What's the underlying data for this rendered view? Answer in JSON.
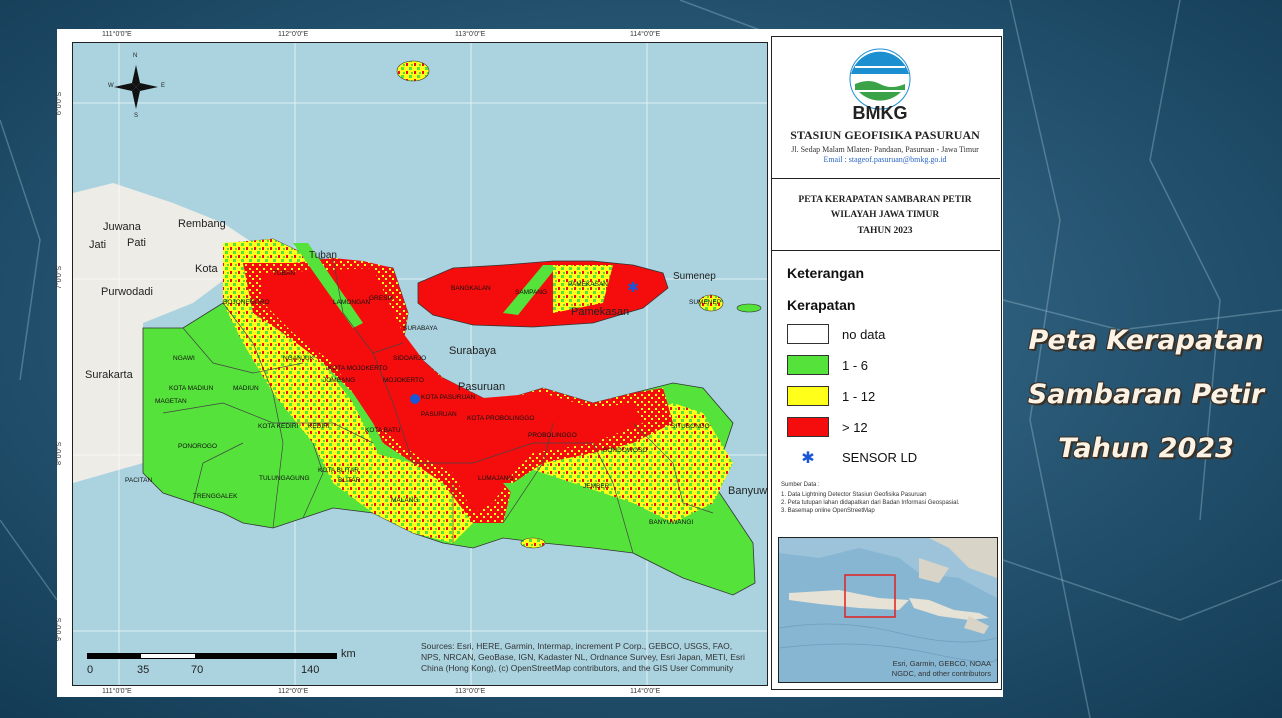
{
  "side_title": [
    "Peta Kerapatan",
    "Sambaran Petir",
    "Tahun 2023"
  ],
  "header": {
    "logo_text": "BMKG",
    "station": "STASIUN GEOFISIKA PASURUAN",
    "address": "Jl. Sedap Malam Mlaten- Pandaan,  Pasuruan - Jawa Timur",
    "email": "Email : stageof.pasuruan@bmkg.go.id"
  },
  "map_title": [
    "PETA KERAPATAN SAMBARAN PETIR",
    "WILAYAH JAWA TIMUR",
    "TAHUN 2023"
  ],
  "legend": {
    "heading": "Keterangan",
    "subheading": "Kerapatan",
    "items": [
      {
        "label": "no data",
        "color": "#ffffff"
      },
      {
        "label": "1 - 6",
        "color": "#55e23a"
      },
      {
        "label": "1 - 12",
        "color": "#ffff1a"
      },
      {
        "label": "> 12",
        "color": "#f50d0d"
      }
    ],
    "sensor_label": "SENSOR LD",
    "sensor_color": "#1a57d8"
  },
  "sources": {
    "heading": "Sumber Data :",
    "items": [
      "1. Data Lightning Detector Stasiun Geofisika Pasuruan",
      "2. Peta tutupan lahan didapatkan dari Badan Informasi Geospasial.",
      "3. Basemap online OpenStreetMap"
    ]
  },
  "coords": {
    "top": [
      "111°0'0\"E",
      "112°0'0\"E",
      "113°0'0\"E",
      "114°0'0\"E"
    ],
    "bottom": [
      "111°0'0\"E",
      "112°0'0\"E",
      "113°0'0\"E",
      "114°0'0\"E"
    ],
    "left": [
      "6°0'0\"S",
      "7°0'0\"S",
      "8°0'0\"S",
      "9°0'0\"S"
    ]
  },
  "scale": {
    "ticks": [
      "0",
      "35",
      "70",
      "140"
    ],
    "unit": "km"
  },
  "attribution": "Sources: Esri, HERE, Garmin, Intermap, increment P Corp., GEBCO, USGS, FAO, NPS, NRCAN, GeoBase, IGN, Kadaster NL, Ordnance Survey, Esri Japan, METI, Esri China (Hong Kong), (c) OpenStreetMap contributors, and the GIS User Community",
  "inset_attribution": [
    "Esri, Garmin, GEBCO, NOAA",
    "NGDC, and other contributors"
  ],
  "basemap_labels": [
    "Juwana",
    "Rembang",
    "Jati",
    "Pati",
    "Kota",
    "Purwodadi",
    "Surakarta",
    "Tuban",
    "Surabaya",
    "Pasuruan",
    "Pamekasan",
    "Sumenep",
    "Banyuwangi"
  ],
  "regions": [
    "TUBAN",
    "LAMONGAN",
    "BOJONEGORO",
    "GRESIK",
    "SURABAYA",
    "NGAWI",
    "NGANJUK",
    "KOTA MADIUN",
    "MADIUN",
    "MAGETAN",
    "KOTA MOJOKERTO",
    "JOMBANG",
    "MOJOKERTO",
    "SIDOARJO",
    "KOTA PASURUAN",
    "PASURUAN",
    "PONOROGO",
    "KOTA KEDIRI",
    "KEDIRI",
    "KOTA BATU",
    "MALANG",
    "PACITAN",
    "TRENGGALEK",
    "TULUNGAGUNG",
    "BLITAR",
    "KOTA BLITAR",
    "LUMAJANG",
    "PROBOLINGGO",
    "KOTA PROBOLINGGO",
    "BONDOWOSO",
    "SITUBONDO",
    "JEMBER",
    "BANYUWANGI",
    "BANGKALAN",
    "SAMPANG",
    "PAMEKASAN",
    "SUMENEP"
  ],
  "north_arrow": {
    "n": "N",
    "s": "S",
    "e": "E",
    "w": "W"
  }
}
